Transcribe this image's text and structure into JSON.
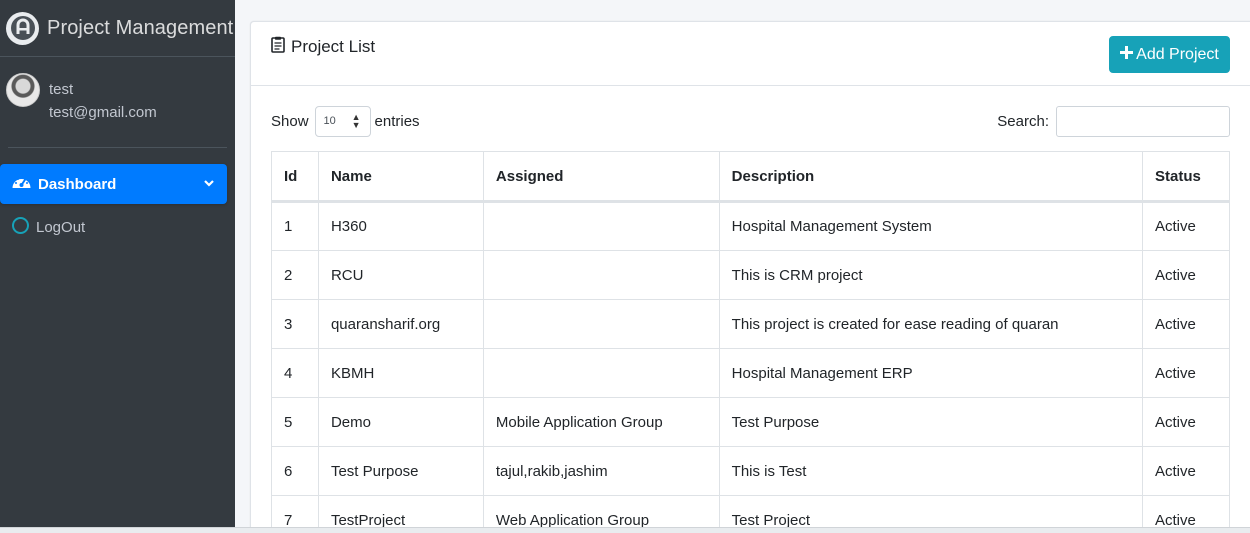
{
  "brand": {
    "title": "Project Management"
  },
  "user": {
    "name": "test",
    "email": "test@gmail.com"
  },
  "nav": {
    "dashboard": "Dashboard",
    "logout": "LogOut"
  },
  "card": {
    "title": "Project List",
    "add_button": "Add Project"
  },
  "controls": {
    "show_label": "Show",
    "entries_value": "10",
    "entries_label": "entries",
    "search_label": "Search:",
    "search_value": ""
  },
  "table": {
    "headers": [
      "Id",
      "Name",
      "Assigned",
      "Description",
      "Status"
    ],
    "rows": [
      [
        "1",
        "H360",
        "",
        "Hospital Management System",
        "Active"
      ],
      [
        "2",
        "RCU",
        "",
        "This is CRM project",
        "Active"
      ],
      [
        "3",
        "quaransharif.org",
        "",
        "This project is created for ease reading of quaran",
        "Active"
      ],
      [
        "4",
        "KBMH",
        "",
        "Hospital Management ERP",
        "Active"
      ],
      [
        "5",
        "Demo",
        "Mobile Application Group",
        "Test Purpose",
        "Active"
      ],
      [
        "6",
        "Test Purpose",
        "tajul,rakib,jashim",
        "This is Test",
        "Active"
      ],
      [
        "7",
        "TestProject",
        "Web Application Group",
        "Test Project",
        "Active"
      ]
    ]
  },
  "colors": {
    "sidebar_bg": "#343a40",
    "active_nav": "#007bff",
    "add_button": "#17a2b8",
    "logout_icon": "#17a2b8"
  },
  "icons": {
    "brand": "brand-logo-icon",
    "dashboard": "tachometer-icon",
    "chevron": "chevron-down-icon",
    "logout": "circle-icon",
    "title": "clipboard-icon",
    "add": "plus-icon",
    "select": "up-down-icon"
  }
}
